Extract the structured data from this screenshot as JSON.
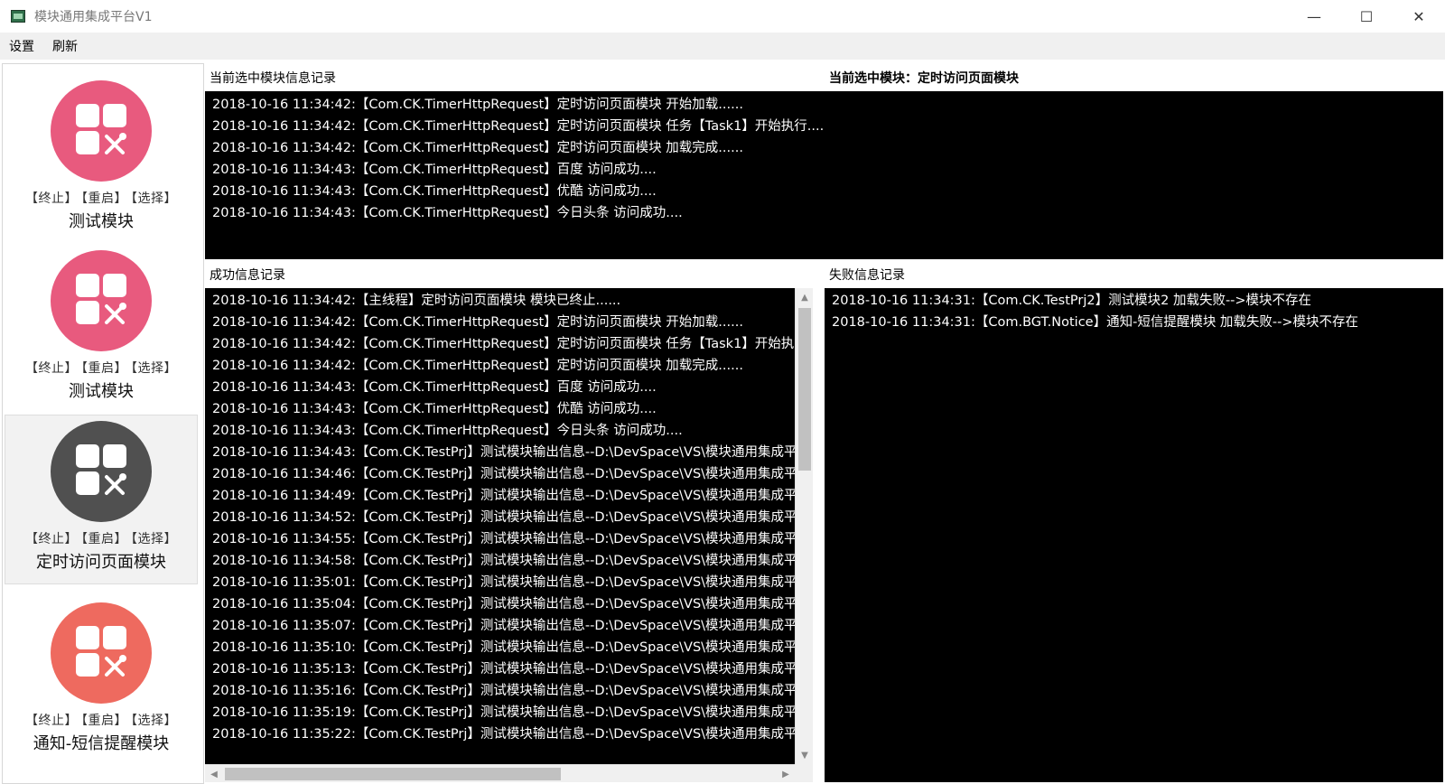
{
  "window": {
    "title": "模块通用集成平台V1",
    "minimize": "—",
    "maximize": "☐",
    "close": "✕"
  },
  "menu": {
    "items": [
      "设置",
      "刷新"
    ]
  },
  "sidebar": {
    "modules": [
      {
        "name": "测试模块",
        "color": "#e85a7e",
        "actions": [
          "【终止】",
          "【重启】",
          "【选择】"
        ]
      },
      {
        "name": "测试模块",
        "color": "#e85a7e",
        "actions": [
          "【终止】",
          "【重启】",
          "【选择】"
        ]
      },
      {
        "name": "定时访问页面模块",
        "color": "#505050",
        "actions": [
          "【终止】",
          "【重启】",
          "【选择】"
        ],
        "selected": true
      },
      {
        "name": "通知-短信提醒模块",
        "color": "#ee6a5f",
        "actions": [
          "【终止】",
          "【重启】",
          "【选择】"
        ]
      }
    ]
  },
  "current": {
    "label": "当前选中模块信息记录",
    "selected_label": "当前选中模块：定时访问页面模块",
    "lines": [
      "2018-10-16 11:34:42:【Com.CK.TimerHttpRequest】定时访问页面模块 开始加载......",
      "2018-10-16 11:34:42:【Com.CK.TimerHttpRequest】定时访问页面模块 任务【Task1】开始执行....",
      "2018-10-16 11:34:42:【Com.CK.TimerHttpRequest】定时访问页面模块 加载完成......",
      "2018-10-16 11:34:43:【Com.CK.TimerHttpRequest】百度 访问成功....",
      "2018-10-16 11:34:43:【Com.CK.TimerHttpRequest】优酷 访问成功....",
      "2018-10-16 11:34:43:【Com.CK.TimerHttpRequest】今日头条 访问成功...."
    ]
  },
  "success": {
    "label": "成功信息记录",
    "lines": [
      "2018-10-16 11:34:42:【主线程】定时访问页面模块 模块已终止......",
      "2018-10-16 11:34:42:【Com.CK.TimerHttpRequest】定时访问页面模块 开始加载......",
      "2018-10-16 11:34:42:【Com.CK.TimerHttpRequest】定时访问页面模块 任务【Task1】开始执",
      "2018-10-16 11:34:42:【Com.CK.TimerHttpRequest】定时访问页面模块 加载完成......",
      "2018-10-16 11:34:43:【Com.CK.TimerHttpRequest】百度 访问成功....",
      "2018-10-16 11:34:43:【Com.CK.TimerHttpRequest】优酷 访问成功....",
      "2018-10-16 11:34:43:【Com.CK.TimerHttpRequest】今日头条 访问成功....",
      "2018-10-16 11:34:43:【Com.CK.TestPrj】测试模块输出信息--D:\\DevSpace\\VS\\模块通用集成平",
      "2018-10-16 11:34:46:【Com.CK.TestPrj】测试模块输出信息--D:\\DevSpace\\VS\\模块通用集成平",
      "2018-10-16 11:34:49:【Com.CK.TestPrj】测试模块输出信息--D:\\DevSpace\\VS\\模块通用集成平",
      "2018-10-16 11:34:52:【Com.CK.TestPrj】测试模块输出信息--D:\\DevSpace\\VS\\模块通用集成平",
      "2018-10-16 11:34:55:【Com.CK.TestPrj】测试模块输出信息--D:\\DevSpace\\VS\\模块通用集成平",
      "2018-10-16 11:34:58:【Com.CK.TestPrj】测试模块输出信息--D:\\DevSpace\\VS\\模块通用集成平",
      "2018-10-16 11:35:01:【Com.CK.TestPrj】测试模块输出信息--D:\\DevSpace\\VS\\模块通用集成平",
      "2018-10-16 11:35:04:【Com.CK.TestPrj】测试模块输出信息--D:\\DevSpace\\VS\\模块通用集成平",
      "2018-10-16 11:35:07:【Com.CK.TestPrj】测试模块输出信息--D:\\DevSpace\\VS\\模块通用集成平",
      "2018-10-16 11:35:10:【Com.CK.TestPrj】测试模块输出信息--D:\\DevSpace\\VS\\模块通用集成平",
      "2018-10-16 11:35:13:【Com.CK.TestPrj】测试模块输出信息--D:\\DevSpace\\VS\\模块通用集成平",
      "2018-10-16 11:35:16:【Com.CK.TestPrj】测试模块输出信息--D:\\DevSpace\\VS\\模块通用集成平",
      "2018-10-16 11:35:19:【Com.CK.TestPrj】测试模块输出信息--D:\\DevSpace\\VS\\模块通用集成平",
      "2018-10-16 11:35:22:【Com.CK.TestPrj】测试模块输出信息--D:\\DevSpace\\VS\\模块通用集成平"
    ]
  },
  "failure": {
    "label": "失败信息记录",
    "lines": [
      "2018-10-16 11:34:31:【Com.CK.TestPrj2】测试模块2 加载失败-->模块不存在",
      "2018-10-16 11:34:31:【Com.BGT.Notice】通知-短信提醒模块 加载失败-->模块不存在"
    ]
  },
  "scroll": {
    "up": "▲",
    "down": "▼",
    "left": "◀",
    "right": "▶"
  }
}
